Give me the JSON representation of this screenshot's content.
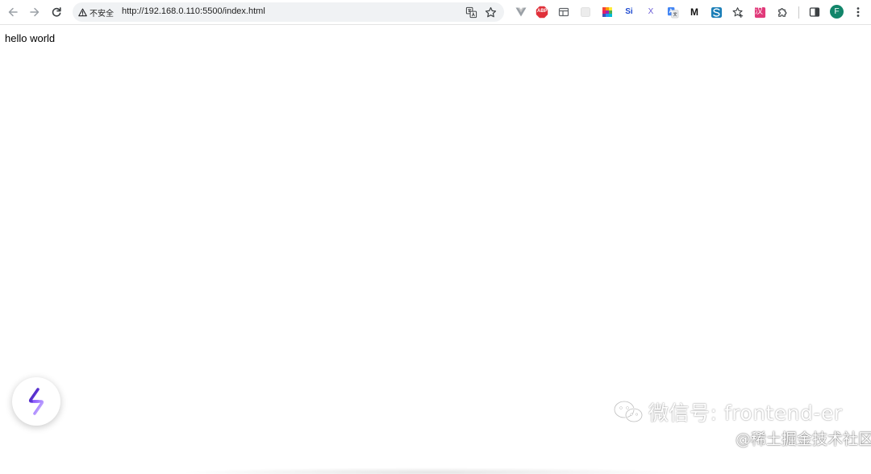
{
  "toolbar": {
    "security_label": "不安全",
    "url": "http://192.168.0.110:5500/index.html",
    "profile_initial": "F",
    "profile_color": "#12856a"
  },
  "extensions": [
    {
      "name": "vue-devtools-icon"
    },
    {
      "name": "adblock-plus-icon",
      "text": "ABP",
      "color": "#e0303a"
    },
    {
      "name": "tab-manager-icon"
    },
    {
      "name": "blank-extension-icon"
    },
    {
      "name": "colorzilla-icon"
    },
    {
      "name": "similarweb-icon",
      "text": "Si",
      "color": "#1f4bd1"
    },
    {
      "name": "x-extension-icon",
      "text": "X",
      "color": "#6a5bd6"
    },
    {
      "name": "google-translate-icon"
    },
    {
      "name": "medium-icon",
      "text": "M",
      "color": "#111111"
    },
    {
      "name": "sync-extension-icon"
    },
    {
      "name": "star-extension-icon"
    },
    {
      "name": "chinese-extension-icon",
      "text": "汉",
      "color": "#e13a7a"
    }
  ],
  "page": {
    "body_text": "hello world"
  },
  "watermark": {
    "wechat": "微信号: frontend-er",
    "juejin": "@稀土掘金技术社区"
  }
}
